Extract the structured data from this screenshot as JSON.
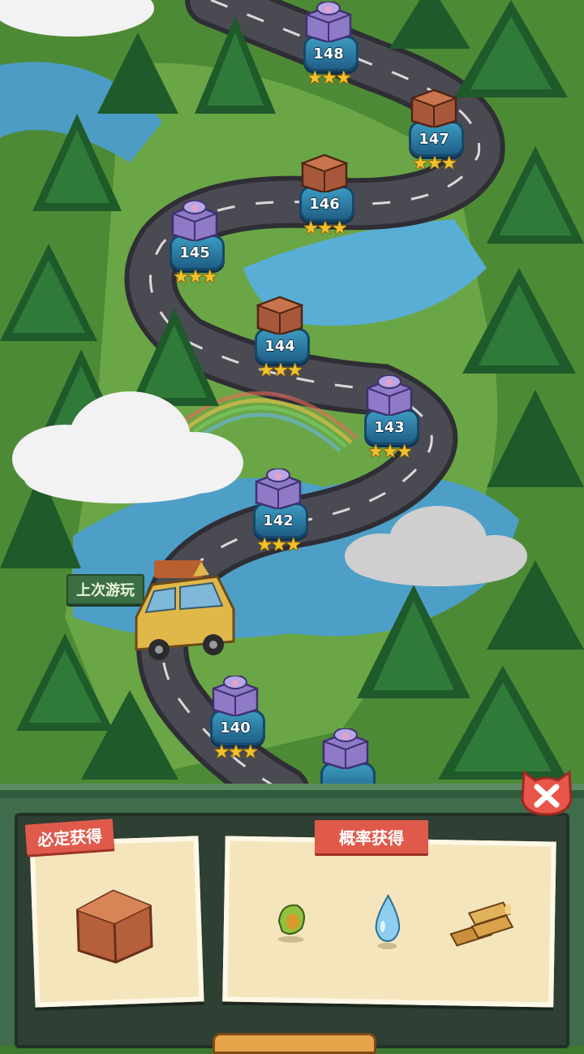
{
  "map": {
    "levels": [
      {
        "num": "148",
        "reward": "gift",
        "stars": 3
      },
      {
        "num": "147",
        "reward": "chest",
        "stars": 3
      },
      {
        "num": "146",
        "reward": "chest",
        "stars": 3
      },
      {
        "num": "145",
        "reward": "gift",
        "stars": 3
      },
      {
        "num": "144",
        "reward": "chest",
        "stars": 3
      },
      {
        "num": "143",
        "reward": "gift",
        "stars": 3
      },
      {
        "num": "142",
        "reward": "gift",
        "stars": 3
      },
      {
        "num": "140",
        "reward": "gift",
        "stars": 3
      },
      {
        "num": "",
        "reward": "gift",
        "stars": 0
      }
    ],
    "last_played_label": "上次游玩",
    "star_glyph": "★"
  },
  "panel": {
    "guaranteed_label": "必定获得",
    "chance_label": "概率获得",
    "guaranteed_items": [
      "wooden-chest-icon"
    ],
    "chance_items": [
      "seed-icon",
      "water-drop-icon",
      "wood-logs-icon"
    ],
    "close_icon": "close-icon"
  },
  "colors": {
    "ribbon": "#e05a4c",
    "panel_green": "#3f6c4b",
    "close_button": "#e8554a"
  }
}
